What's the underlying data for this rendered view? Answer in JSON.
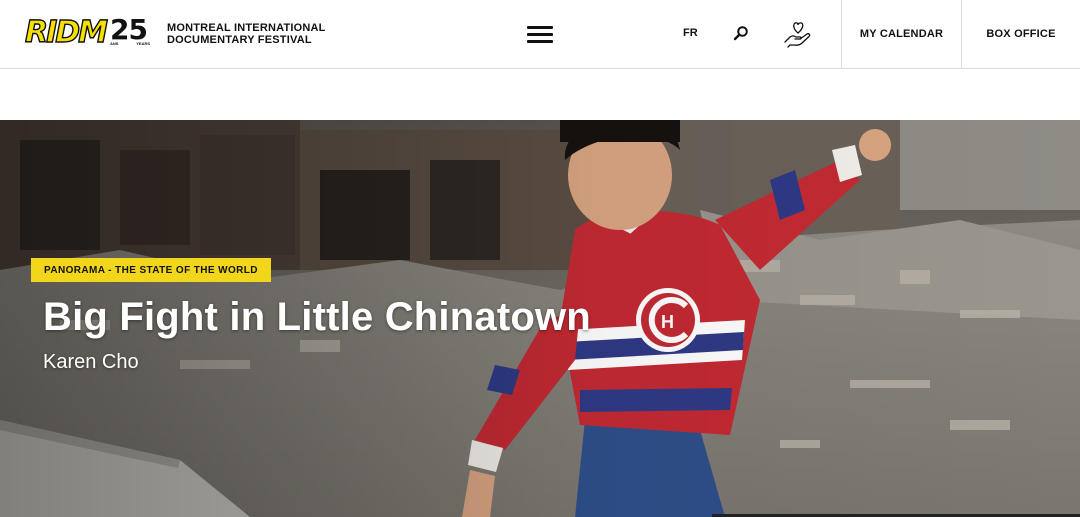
{
  "header": {
    "logo_text": "RIDM",
    "logo_anniversary": "25",
    "logo_sub_left": "ANS",
    "logo_sub_right": "YEARS",
    "festival_line1": "MONTREAL INTERNATIONAL",
    "festival_line2": "DOCUMENTARY FESTIVAL",
    "language_toggle": "FR",
    "nav": {
      "my_calendar": "MY CALENDAR",
      "box_office": "BOX OFFICE"
    },
    "icons": {
      "menu": "hamburger-menu-icon",
      "search": "search-icon",
      "donate": "donate-hand-heart-icon"
    }
  },
  "hero": {
    "section_badge": "PANORAMA - THE STATE OF THE WORLD",
    "film_title": "Big Fight in Little Chinatown",
    "director": "Karen Cho"
  },
  "colors": {
    "accent_yellow": "#f2d61b",
    "text_dark": "#111111",
    "jersey_red": "#c42a33",
    "jersey_blue": "#2f3a86"
  }
}
